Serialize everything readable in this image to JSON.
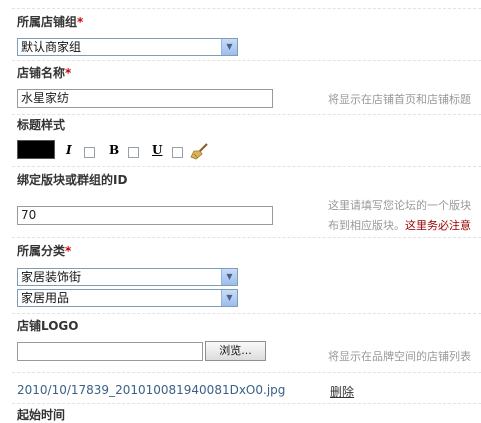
{
  "store_group": {
    "label": "所属店铺组",
    "required_mark": "*",
    "selected": "默认商家组"
  },
  "store_name": {
    "label": "店铺名称",
    "required_mark": "*",
    "value": "水星家纺",
    "hint": "将显示在店铺首页和店铺标题"
  },
  "title_style": {
    "label": "标题样式",
    "color_value": "#000000",
    "italic_label": "I",
    "bold_label": "B",
    "underline_label": "U",
    "icons": [
      "color-swatch",
      "broom-icon"
    ]
  },
  "bind_id": {
    "label": "绑定版块或群组的ID",
    "value": "70",
    "hint_line1": "这里请填写您论坛的一个版块",
    "hint_line2": "布到相应版块。",
    "hint_warning": "这里务必注意"
  },
  "category": {
    "label": "所属分类",
    "required_mark": "*",
    "primary": "家居装饰街",
    "secondary": "家居用品"
  },
  "logo": {
    "label": "店铺LOGO",
    "file_value": "",
    "browse_label": "浏览...",
    "hint": "将显示在品牌空间的店铺列表",
    "current_file": "2010/10/17839_201010081940081DxO0.jpg",
    "delete_label": "删除"
  },
  "start_time": {
    "label": "起始时间"
  },
  "colors": {
    "required": "#cc0000",
    "link": "#3b5f86",
    "hint": "#999999",
    "warning": "#990000"
  }
}
